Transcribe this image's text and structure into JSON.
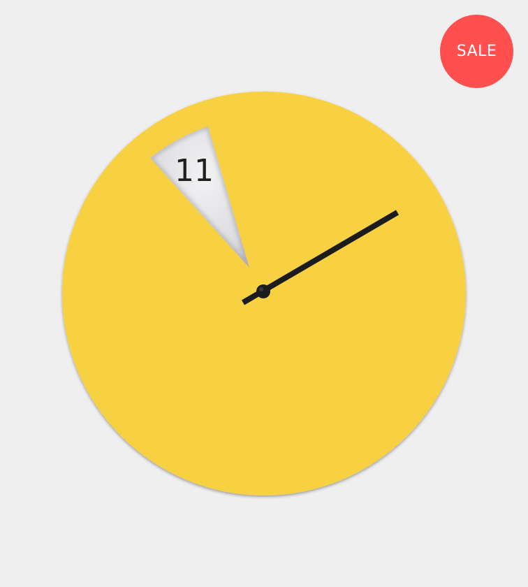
{
  "badge": {
    "label": "SALE",
    "color": "#ff4f4f"
  },
  "product": {
    "dial_color": "#f7d143",
    "cutout_color": "#d9d9dd",
    "hand_color": "#1c1c1c",
    "visible_hour": "11"
  },
  "background_color": "#efefef"
}
